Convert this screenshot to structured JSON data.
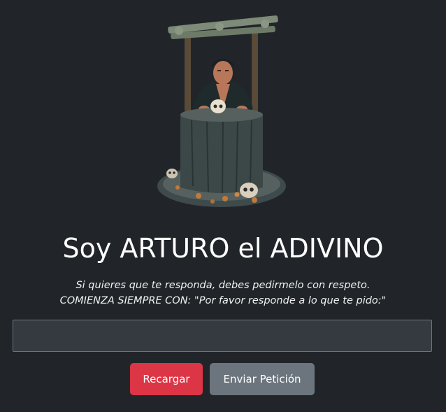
{
  "header": {
    "title": "Soy ARTURO el ADIVINO",
    "subtitle_line1": "Si quieres que te responda, debes pedirmelo con respeto.",
    "subtitle_line2": "COMIENZA SIEMPRE CON: \"Por favor responde a lo que te pido:\""
  },
  "form": {
    "input_value": "",
    "input_placeholder": ""
  },
  "buttons": {
    "reload_label": "Recargar",
    "send_label": "Enviar Petición"
  },
  "colors": {
    "background": "#212529",
    "reload": "#dc3545",
    "send": "#6c757d"
  },
  "hero_image": {
    "icon": "fortune-teller-well-illustration"
  }
}
